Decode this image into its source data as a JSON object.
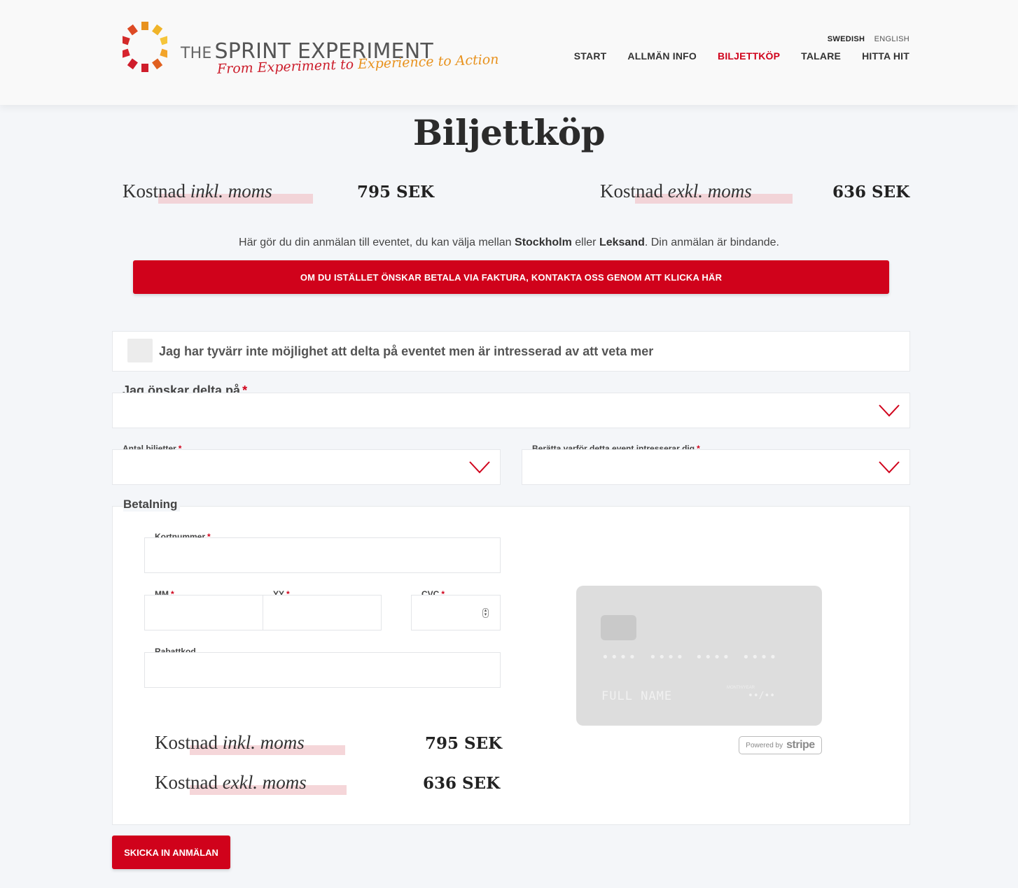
{
  "header": {
    "brand_prefix": "THE",
    "brand_name": "SPRINT EXPERIMENT",
    "tagline_part1": "From Experiment",
    "tagline_part2": "to",
    "tagline_part3": "Experience",
    "tagline_part4": "to",
    "tagline_part5": "Action",
    "languages": [
      "SWEDISH",
      "ENGLISH"
    ],
    "nav": [
      "START",
      "ALLMÄN INFO",
      "BILJETTKÖP",
      "TALARE",
      "HITTA HIT"
    ]
  },
  "page": {
    "title": "Biljettköp",
    "cost_prefix": "Kostnad",
    "incl_label": "inkl. moms",
    "excl_label": "exkl. moms",
    "incl_price": "795 SEK",
    "excl_price": "636 SEK",
    "intro_1": "Här gör du din anmälan till eventet, du kan välja mellan ",
    "intro_city1": "Stockholm",
    "intro_2": " eller ",
    "intro_city2": "Leksand",
    "intro_3": ". Din anmälan är bindande.",
    "invoice_button": "OM DU ISTÄLLET ÖNSKAR BETALA VIA FAKTURA, KONTAKTA OSS GENOM ATT KLICKA HÄR"
  },
  "form": {
    "not_attending_label": "Jag har tyvärr inte möjlighet att delta på eventet men är intresserad av att veta mer",
    "event_label": "Jag önskar delta på",
    "tickets_label": "Antal biljetter",
    "reason_label": "Berätta varför detta event intresserar dig",
    "required_mark": "*",
    "payment_legend": "Betalning",
    "card_number_label": "Kortnummer",
    "mm_label": "MM",
    "yy_label": "YY",
    "cvc_label": "CVC",
    "discount_label": "Rabattkod",
    "submit_button": "SKICKA IN ANMÄLAN"
  },
  "card_preview": {
    "number_groups": [
      "••••",
      "••••",
      "••••",
      "••••"
    ],
    "name": "FULL NAME",
    "valid_thru": "VALID\nTHRU",
    "month_year": "MONTH/YEAR",
    "expiry": "••/••"
  },
  "stripe": {
    "powered_by": "Powered by",
    "brand": "stripe"
  },
  "colors": {
    "accent": "#d0021b",
    "highlight": "#f1c8cc",
    "background": "#f4f6f9"
  }
}
